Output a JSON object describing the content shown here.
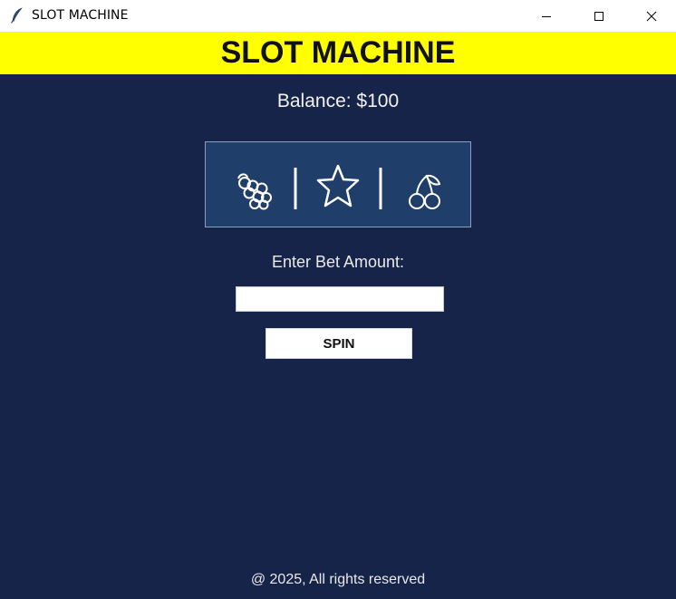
{
  "window": {
    "title": "SLOT MACHINE",
    "icon": "feather-icon",
    "controls": [
      "minimize-icon",
      "maximize-icon",
      "close-icon"
    ]
  },
  "banner": {
    "title": "SLOT MACHINE",
    "background": "#ffff00"
  },
  "balance": {
    "label": "Balance: $100"
  },
  "reels": {
    "symbols": [
      "grapes-icon",
      "star-icon",
      "cherry-icon"
    ],
    "background": "#1f3e6a"
  },
  "bet": {
    "label": "Enter Bet Amount:",
    "value": ""
  },
  "spin": {
    "label": "SPIN"
  },
  "footer": {
    "text": "@ 2025, All rights reserved"
  },
  "colors": {
    "page_background": "#16244a",
    "accent": "#ffff00"
  }
}
